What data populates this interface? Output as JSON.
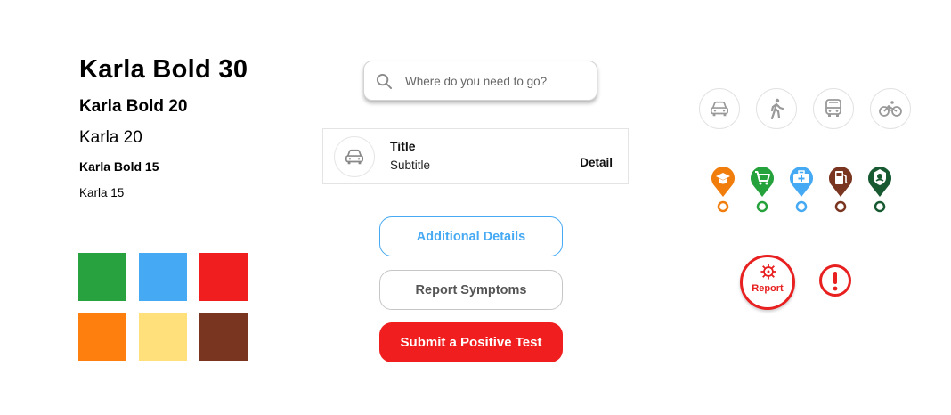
{
  "typography": {
    "karla_bold_30": "Karla Bold 30",
    "karla_bold_20": "Karla Bold 20",
    "karla_20": "Karla 20",
    "karla_bold_15": "Karla Bold 15",
    "karla_15": "Karla 15"
  },
  "palette": {
    "green": "#27a23f",
    "blue": "#45a9f3",
    "red": "#f01e1e",
    "orange": "#ff7f0e",
    "yellow": "#ffe07a",
    "brown": "#7a3520"
  },
  "search": {
    "placeholder": "Where do you need to go?",
    "icon": "search-icon"
  },
  "list_item": {
    "icon": "car-icon",
    "title": "Title",
    "subtitle": "Subtitle",
    "detail": "Detail"
  },
  "buttons": {
    "additional_details": "Additional Details",
    "report_symptoms": "Report Symptoms",
    "submit_positive_test": "Submit a Positive Test"
  },
  "transport_modes": [
    "car-icon",
    "walk-icon",
    "bus-icon",
    "bike-icon"
  ],
  "pins": [
    {
      "icon": "graduation-cap-icon",
      "color": "#f07d0c"
    },
    {
      "icon": "shopping-cart-icon",
      "color": "#26a23d"
    },
    {
      "icon": "medical-bag-icon",
      "color": "#45a9f3"
    },
    {
      "icon": "fuel-pump-icon",
      "color": "#7a3520"
    },
    {
      "icon": "plant-icon",
      "color": "#175a32"
    }
  ],
  "report": {
    "label": "Report",
    "icon": "virus-icon",
    "color": "#e82020"
  },
  "alert": {
    "icon": "alert-icon",
    "color": "#e82020"
  }
}
